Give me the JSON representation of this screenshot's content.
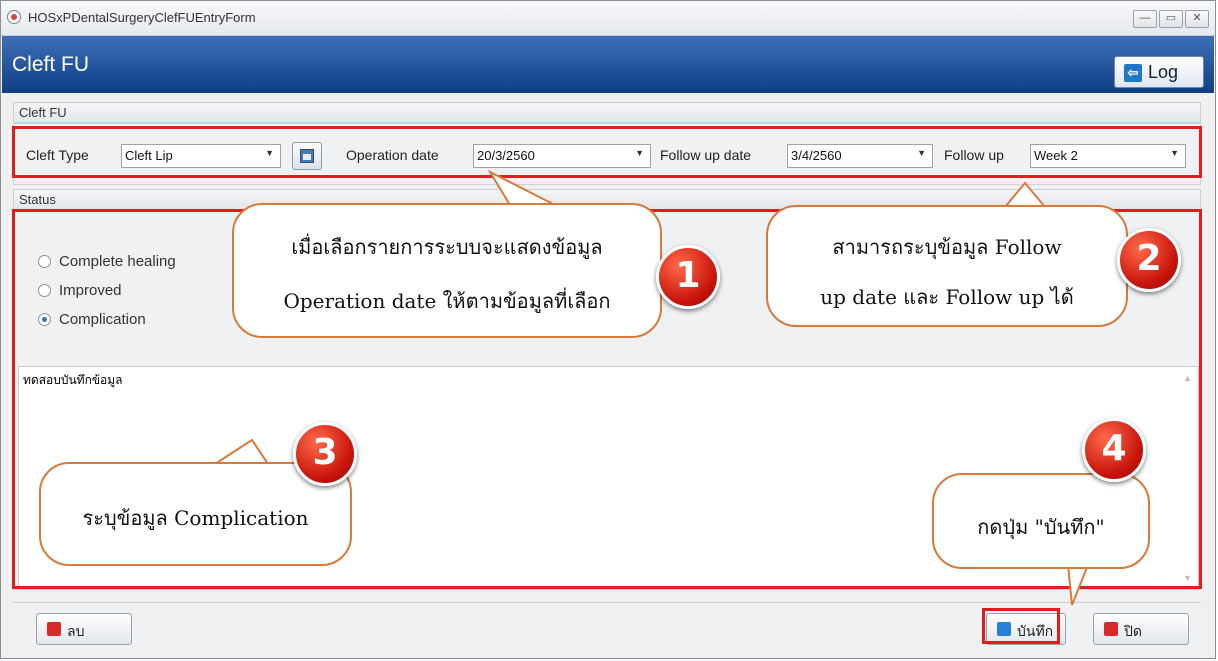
{
  "window": {
    "title": "HOSxPDentalSurgeryClefFUEntryForm",
    "minimize": "—",
    "maximize": "▭",
    "close": "✕"
  },
  "header": {
    "title": "Cleft FU",
    "log_label": "Log",
    "log_icon_glyph": "⇦"
  },
  "cleft_group": {
    "title": "Cleft FU",
    "cleft_type_label": "Cleft Type",
    "cleft_type_value": "Cleft Lip",
    "operation_date_label": "Operation date",
    "operation_date_value": "20/3/2560",
    "follow_up_date_label": "Follow up date",
    "follow_up_date_value": "3/4/2560",
    "follow_up_label": "Follow up",
    "follow_up_value": "Week 2",
    "dropdown_arrow": "▼"
  },
  "status_group": {
    "title": "Status",
    "options": [
      "Complete healing",
      "Improved",
      "Complication"
    ],
    "selected": "Complication",
    "memo_text": "ทดสอบบันทึกข้อมูล"
  },
  "buttons": {
    "delete": "ลบ",
    "save": "บันทึก",
    "close": "ปิด"
  },
  "annotations": {
    "callout1_line1": "เมื่อเลือกรายการระบบจะแสดงข้อมูล",
    "callout1_line2": "Operation date ให้ตามข้อมูลที่เลือก",
    "callout2_line1": "สามารถระบุข้อมูล Follow",
    "callout2_line2": "up date และ Follow up ได้",
    "callout3": "ระบุข้อมูล Complication",
    "callout4": "กดปุ่ม \"บันทึก\"",
    "badge1": "1",
    "badge2": "2",
    "badge3": "3",
    "badge4": "4"
  },
  "colors": {
    "header_blue": "#1a4a94",
    "highlight_red": "#e21d1d",
    "callout_border": "#d77a3a"
  }
}
